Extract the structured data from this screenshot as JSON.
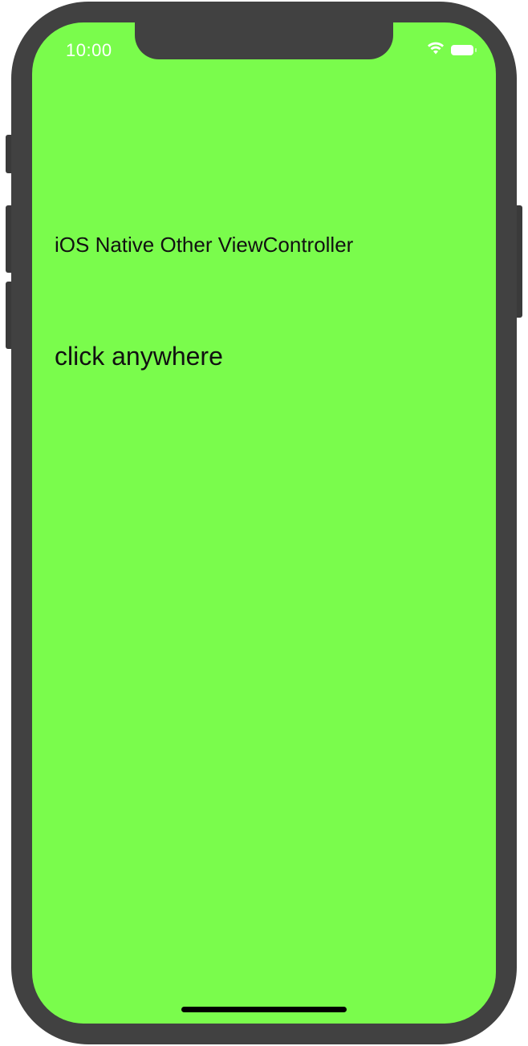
{
  "status_bar": {
    "time": "10:00",
    "wifi_icon": "wifi-icon",
    "battery_icon": "battery-icon"
  },
  "main": {
    "title": "iOS Native Other ViewController",
    "hint": "click anywhere"
  },
  "colors": {
    "screen_background": "#7afc4c",
    "device_frame": "#414141",
    "text": "#111111"
  }
}
